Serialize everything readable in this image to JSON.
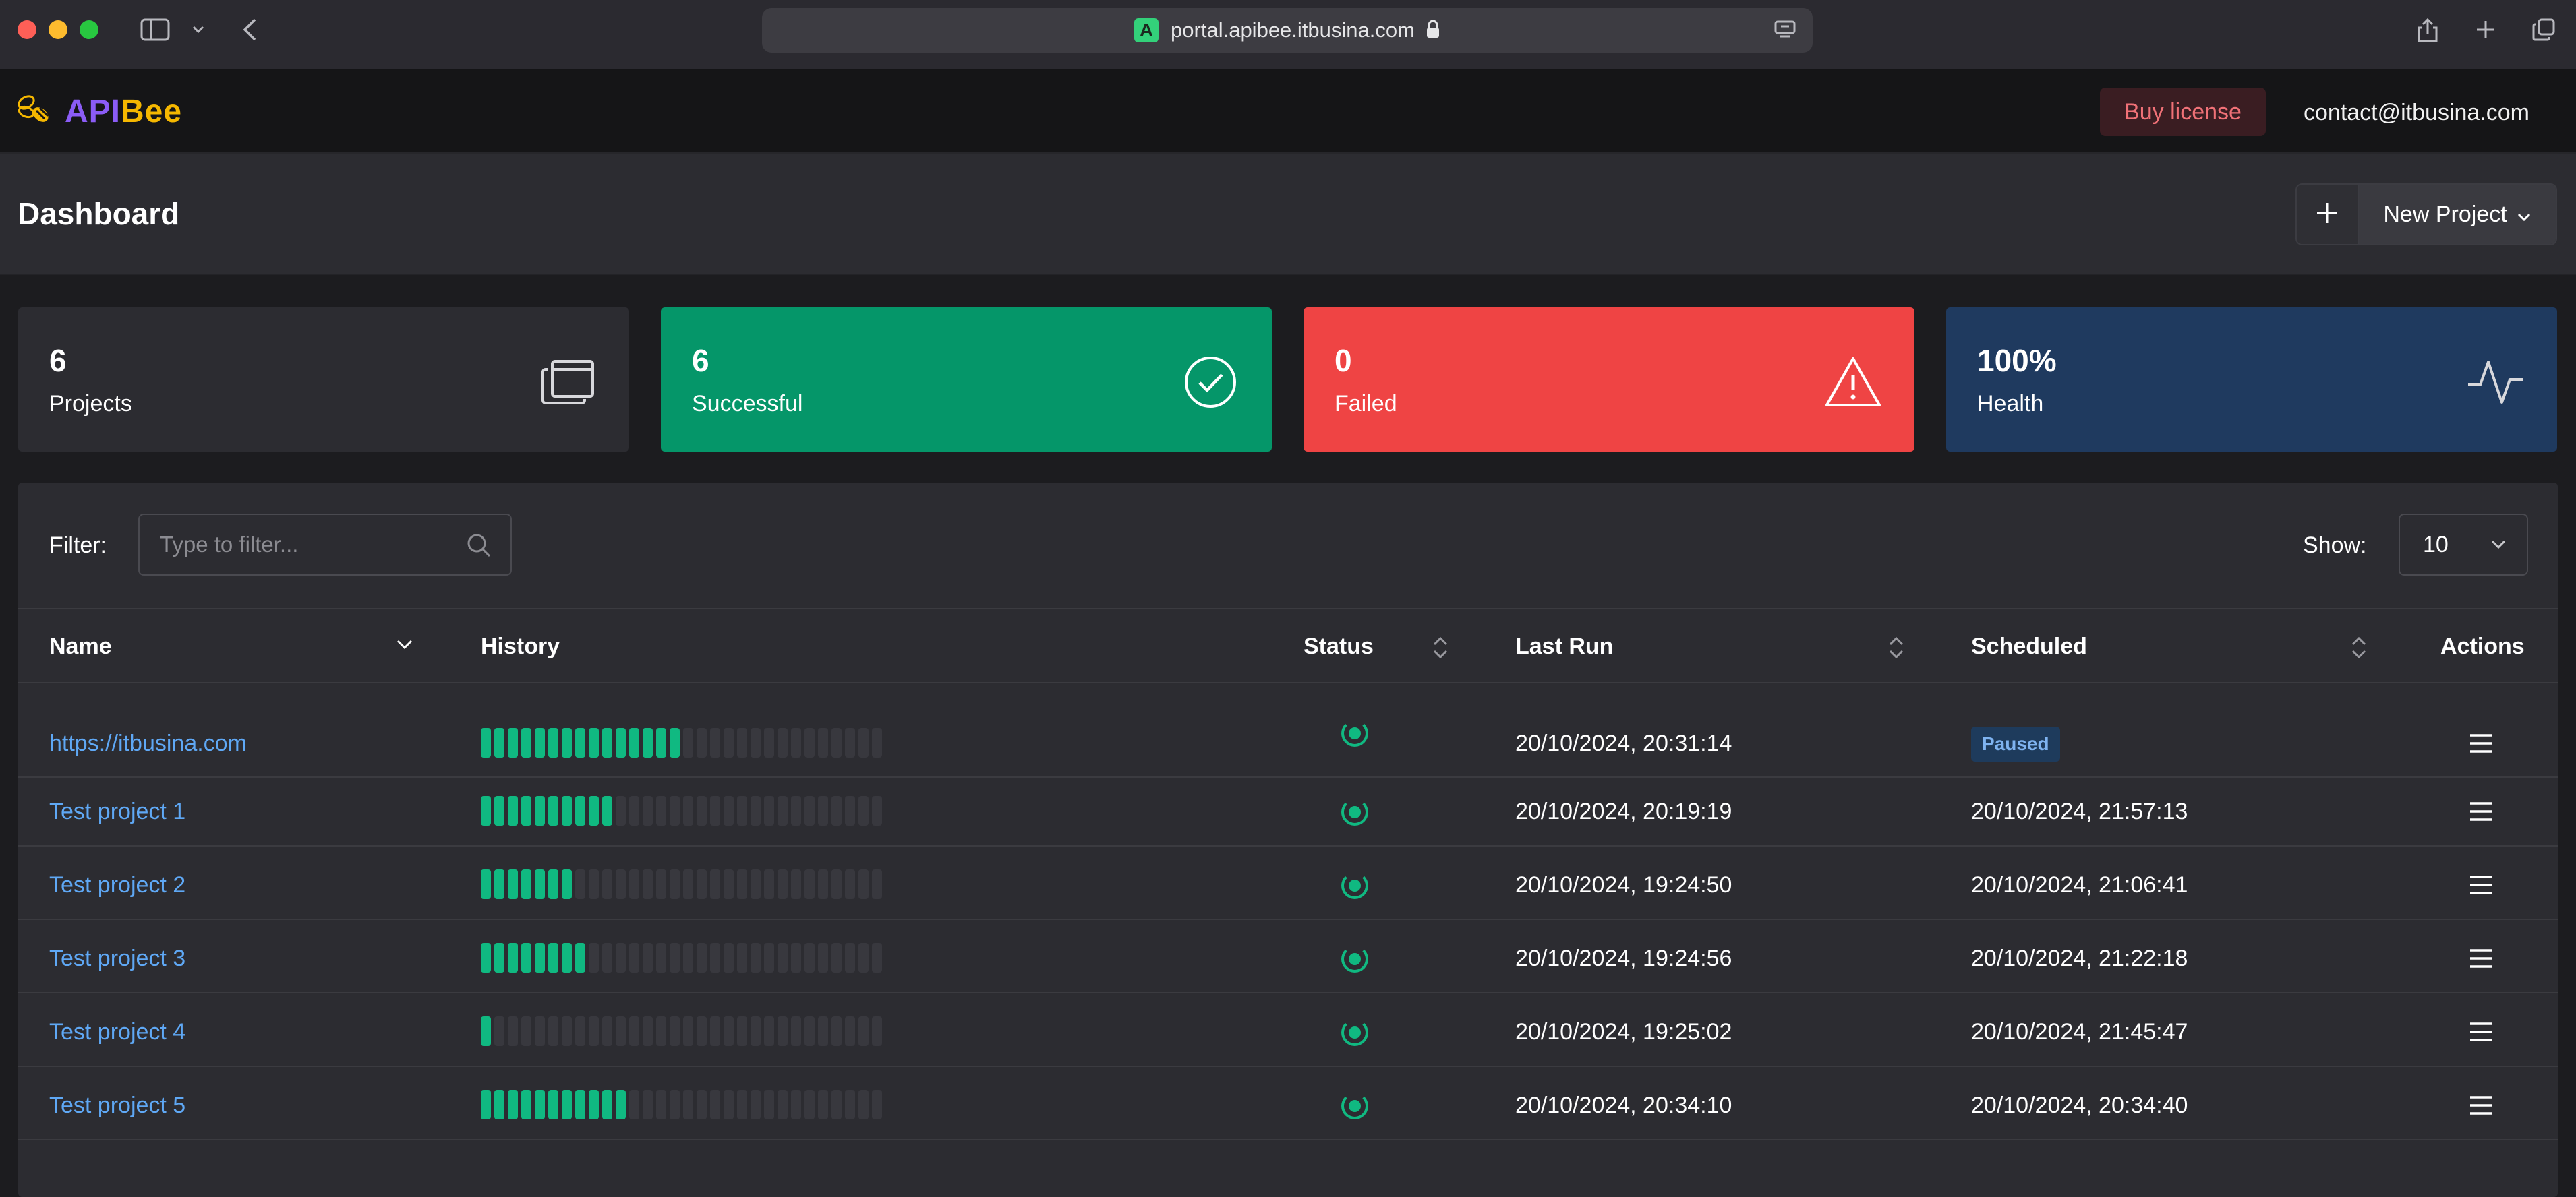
{
  "browser": {
    "url": "portal.apibee.itbusina.com",
    "site_badge": "A"
  },
  "header": {
    "logo_prefix": "API",
    "logo_suffix": "Bee",
    "buy_label": "Buy license",
    "contact": "contact@itbusina.com"
  },
  "page": {
    "title": "Dashboard",
    "new_project_label": "New Project"
  },
  "stats": [
    {
      "value": "6",
      "label": "Projects",
      "icon": "projects-icon"
    },
    {
      "value": "6",
      "label": "Successful",
      "icon": "check-circle-icon"
    },
    {
      "value": "0",
      "label": "Failed",
      "icon": "warning-icon"
    },
    {
      "value": "100%",
      "label": "Health",
      "icon": "pulse-icon"
    }
  ],
  "colors": {
    "success": "#059669",
    "failed": "#ef4444",
    "health": "#1f3a5f",
    "link": "#5fa8f5",
    "accent_bar": "#10b981"
  },
  "table": {
    "filter_label": "Filter:",
    "filter_placeholder": "Type to filter...",
    "show_label": "Show:",
    "show_value": "10",
    "columns": {
      "name": "Name",
      "history": "History",
      "status": "Status",
      "last_run": "Last Run",
      "scheduled": "Scheduled",
      "actions": "Actions"
    },
    "history_length": 30,
    "rows": [
      {
        "name": "https://itbusina.com",
        "history_success": 15,
        "last_run": "20/10/2024, 20:31:14",
        "scheduled": "Paused",
        "paused": true
      },
      {
        "name": "Test project 1",
        "history_success": 10,
        "last_run": "20/10/2024, 20:19:19",
        "scheduled": "20/10/2024, 21:57:13",
        "paused": false
      },
      {
        "name": "Test project 2",
        "history_success": 7,
        "last_run": "20/10/2024, 19:24:50",
        "scheduled": "20/10/2024, 21:06:41",
        "paused": false
      },
      {
        "name": "Test project 3",
        "history_success": 8,
        "last_run": "20/10/2024, 19:24:56",
        "scheduled": "20/10/2024, 21:22:18",
        "paused": false
      },
      {
        "name": "Test project 4",
        "history_success": 1,
        "last_run": "20/10/2024, 19:25:02",
        "scheduled": "20/10/2024, 21:45:47",
        "paused": false
      },
      {
        "name": "Test project 5",
        "history_success": 11,
        "last_run": "20/10/2024, 20:34:10",
        "scheduled": "20/10/2024, 20:34:40",
        "paused": false
      }
    ]
  }
}
